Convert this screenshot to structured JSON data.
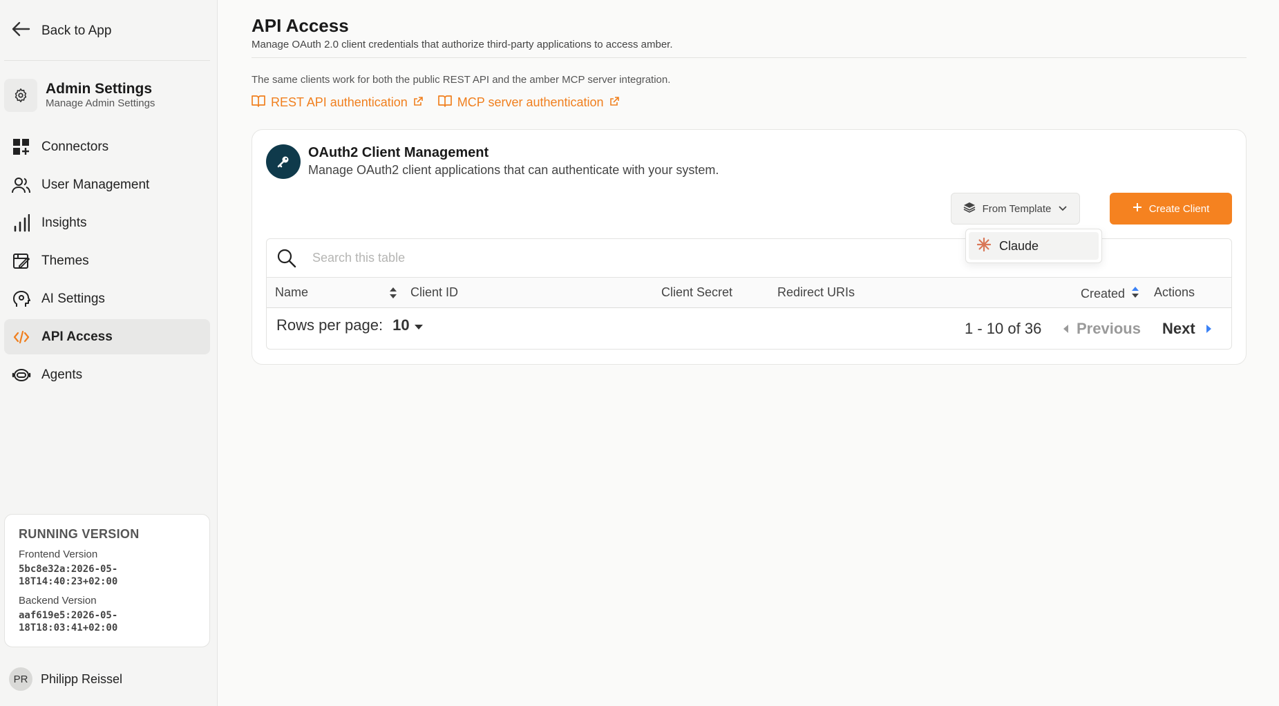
{
  "sidebar": {
    "back_label": "Back to App",
    "admin_title": "Admin Settings",
    "admin_subtitle": "Manage Admin Settings",
    "items": [
      {
        "label": "Connectors",
        "icon": "grid-plus-icon"
      },
      {
        "label": "User Management",
        "icon": "users-icon"
      },
      {
        "label": "Insights",
        "icon": "bar-chart-icon"
      },
      {
        "label": "Themes",
        "icon": "palette-icon"
      },
      {
        "label": "AI Settings",
        "icon": "ai-head-icon"
      },
      {
        "label": "API Access",
        "icon": "code-icon",
        "active": true
      },
      {
        "label": "Agents",
        "icon": "bot-icon"
      }
    ],
    "version": {
      "heading": "RUNNING VERSION",
      "frontend_label": "Frontend Version",
      "frontend_value": "5bc8e32a:2026-05-18T14:40:23+02:00",
      "backend_label": "Backend Version",
      "backend_value": "aaf619e5:2026-05-18T18:03:41+02:00"
    },
    "user": {
      "initials": "PR",
      "name": "Philipp Reissel"
    }
  },
  "main": {
    "title": "API Access",
    "description": "Manage OAuth 2.0 client credentials that authorize third-party applications to access amber.",
    "note": "The same clients work for both the public REST API and the amber MCP server integration.",
    "links": {
      "rest": "REST API authentication",
      "mcp": "MCP server authentication"
    },
    "card": {
      "title": "OAuth2 Client Management",
      "description": "Manage OAuth2 client applications that can authenticate with your system.",
      "from_template_label": "From Template",
      "create_label": "Create Client",
      "search_placeholder": "Search this table",
      "columns": {
        "name": "Name",
        "client_id": "Client ID",
        "client_secret": "Client Secret",
        "redirect_uris": "Redirect URIs",
        "created": "Created",
        "actions": "Actions"
      },
      "rows_per_page_label": "Rows per page:",
      "rows_per_page_value": "10",
      "page_info": "1 - 10 of 36",
      "previous_label": "Previous",
      "next_label": "Next"
    },
    "template_dropdown": {
      "items": [
        {
          "label": "Claude",
          "icon": "claude-spark-icon"
        }
      ]
    }
  },
  "colors": {
    "accent": "#f58220",
    "link": "#f07f1e",
    "key_icon_bg": "#0f3a4b",
    "sort_blue": "#3b82f6"
  }
}
